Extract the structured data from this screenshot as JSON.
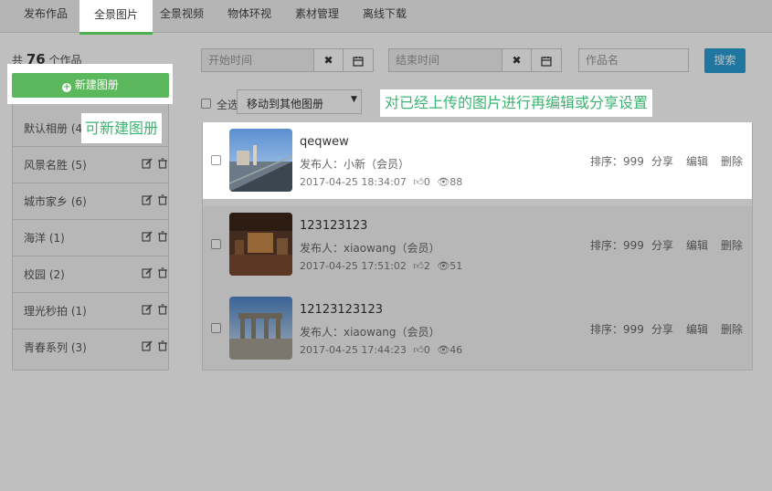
{
  "tabs": [
    "发布作品",
    "全景图片",
    "全景视频",
    "物体环视",
    "素材管理",
    "离线下载"
  ],
  "count": {
    "prefix": "共",
    "number": "76",
    "suffix": "个作品"
  },
  "new_album_label": "新建图册",
  "albums": [
    "默认相册 (41)",
    "风景名胜 (5)",
    "城市家乡 (6)",
    "海洋 (1)",
    "校园 (2)",
    "理光秒拍 (1)",
    "青春系列 (3)"
  ],
  "filters": {
    "start_placeholder": "开始时间",
    "end_placeholder": "结束时间",
    "name_placeholder": "作品名",
    "search_label": "搜索",
    "select_all_label": "全选",
    "move_label": "移动到其他图册"
  },
  "tips": {
    "new_album": "可新建图册",
    "edit_share": "对已经上传的图片进行再编辑或分享设置"
  },
  "items": [
    {
      "title": "qeqwew",
      "publisher": "发布人：小新（会员）",
      "date": "2017-04-25 18:34:07",
      "likes": "0",
      "views": "88",
      "sort": "排序：999"
    },
    {
      "title": "123123123",
      "publisher": "发布人：xiaowang（会员）",
      "date": "2017-04-25 17:51:02",
      "likes": "2",
      "views": "51",
      "sort": "排序：999"
    },
    {
      "title": "12123123123",
      "publisher": "发布人：xiaowang（会员）",
      "date": "2017-04-25 17:44:23",
      "likes": "0",
      "views": "46",
      "sort": "排序：999"
    }
  ],
  "actions": {
    "share": "分享",
    "edit": "编辑",
    "delete": "删除"
  },
  "colors": {
    "accent_green": "#5cb85c",
    "search_blue": "#2a9fd6",
    "tip_green": "#3cb371"
  }
}
